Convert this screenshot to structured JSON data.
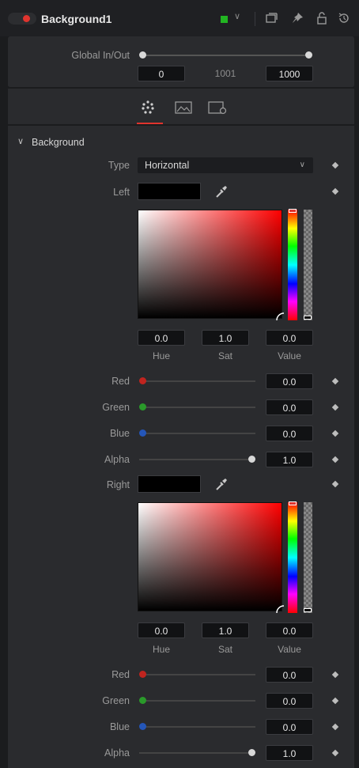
{
  "header": {
    "title": "Background1",
    "node_color": "#22b522",
    "active_color": "#e0342e",
    "icons": [
      "window-icon",
      "pin-icon",
      "lock-icon",
      "reset-icon"
    ]
  },
  "global": {
    "label": "Global In/Out",
    "in_value": "0",
    "mid_value": "1001",
    "out_value": "1000"
  },
  "tabs": [
    {
      "name": "color-tab",
      "active": true
    },
    {
      "name": "image-tab",
      "active": false
    },
    {
      "name": "settings-tab",
      "active": false
    }
  ],
  "section": {
    "title": "Background",
    "type_label": "Type",
    "type_value": "Horizontal"
  },
  "left": {
    "label": "Left",
    "hue": "0.0",
    "sat": "1.0",
    "value": "0.0",
    "hue_label": "Hue",
    "sat_label": "Sat",
    "value_label": "Value",
    "red_label": "Red",
    "red_value": "0.0",
    "green_label": "Green",
    "green_value": "0.0",
    "blue_label": "Blue",
    "blue_value": "0.0",
    "alpha_label": "Alpha",
    "alpha_value": "1.0"
  },
  "right": {
    "label": "Right",
    "hue": "0.0",
    "sat": "1.0",
    "value": "0.0",
    "hue_label": "Hue",
    "sat_label": "Sat",
    "value_label": "Value",
    "red_label": "Red",
    "red_value": "0.0",
    "green_label": "Green",
    "green_value": "0.0",
    "blue_label": "Blue",
    "blue_value": "0.0",
    "alpha_label": "Alpha",
    "alpha_value": "1.0"
  },
  "channel_colors": {
    "red": "#c0241f",
    "green": "#2a9a2a",
    "blue": "#2456b8"
  }
}
